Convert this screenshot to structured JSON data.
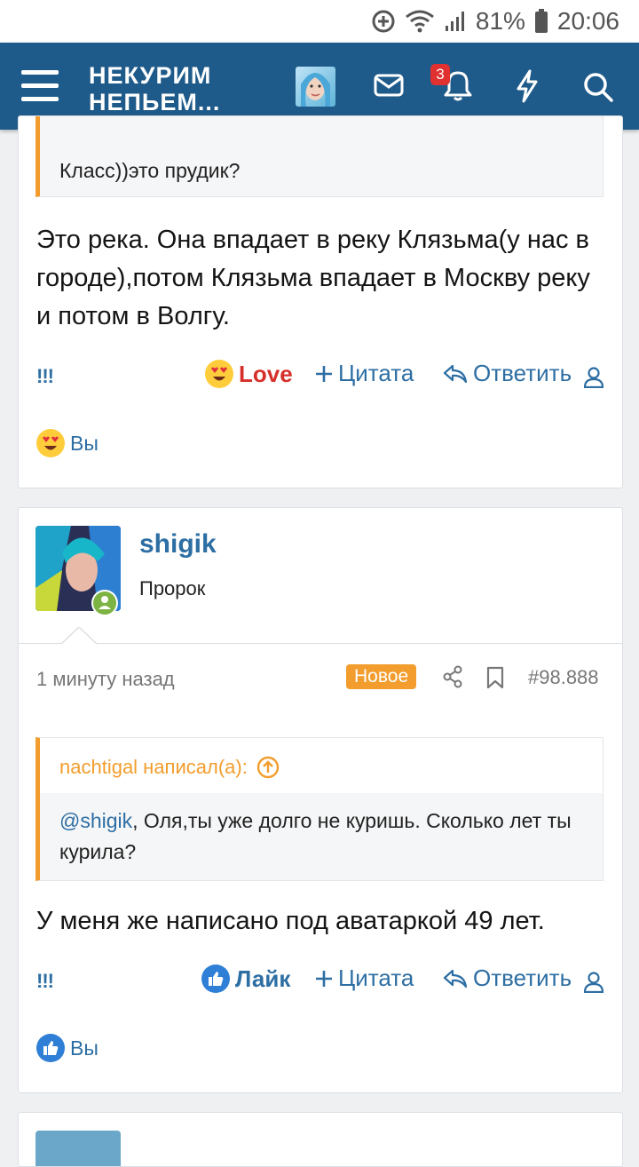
{
  "status": {
    "battery_pct": "81%",
    "time": "20:06"
  },
  "header": {
    "logo_line1": "НЕКУРИМ",
    "logo_line2": "НЕПЬЕМ...",
    "notifications_count": "3"
  },
  "post1": {
    "quote_text": "Класс))это прудик?",
    "message": "Это река. Она впадает в реку Клязьма(у нас в городе),потом Клязьма впадает в Москву реку и потом в Волгу.",
    "actions": {
      "report": "!!!",
      "reaction": "Love",
      "quote": "Цитата",
      "reply": "Ответить"
    },
    "reacted_by": "Вы"
  },
  "post2": {
    "author": "shigik",
    "author_title": "Пророк",
    "time": "1 минуту назад",
    "new_badge": "Новое",
    "post_number": "#98.888",
    "quote_author": "nachtigal написал(а):",
    "quote_mention": "@shigik",
    "quote_text": ", Оля,ты уже долго не куришь. Сколько лет ты курила?",
    "message": "У меня же написано под аватаркой 49 лет.",
    "actions": {
      "report": "!!!",
      "reaction": "Лайк",
      "quote": "Цитата",
      "reply": "Ответить"
    },
    "reacted_by": "Вы"
  },
  "colors": {
    "brand": "#1f5b8a",
    "link": "#2d6ea3",
    "accent": "#f29d2d",
    "love": "#d6302b"
  }
}
